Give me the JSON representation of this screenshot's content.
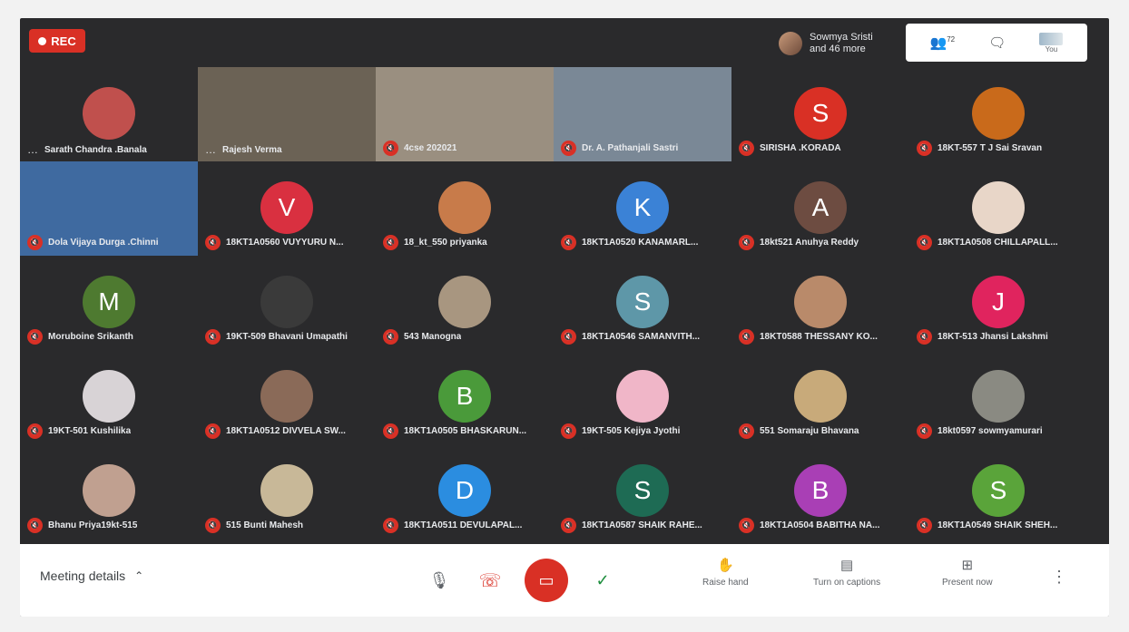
{
  "recording": {
    "label": "REC"
  },
  "presenter": {
    "line1": "Sowmya Sristi",
    "line2": "and 46 more"
  },
  "top_panel": {
    "participant_count": "72",
    "you_label": "You"
  },
  "tiles": [
    {
      "name": "Sarath Chandra .Banala",
      "kind": "photo",
      "color": "#c0504d",
      "status": "more"
    },
    {
      "name": "Rajesh Verma",
      "kind": "video",
      "color": "#6b6255",
      "status": "more"
    },
    {
      "name": "4cse 202021",
      "kind": "video",
      "color": "#9a8f80",
      "status": "muted"
    },
    {
      "name": "Dr. A. Pathanjali Sastri",
      "kind": "video",
      "color": "#7a8896",
      "status": "muted"
    },
    {
      "name": "SIRISHA .KORADA",
      "kind": "letter",
      "letter": "S",
      "color": "#d93025",
      "status": "muted"
    },
    {
      "name": "18KT-557 T J Sai Sravan",
      "kind": "photo",
      "color": "#c96a1b",
      "status": "muted"
    },
    {
      "name": "Dola Vijaya Durga .Chinni",
      "kind": "video",
      "color": "#3f6aa0",
      "status": "muted"
    },
    {
      "name": "18KT1A0560 VUYYURU N...",
      "kind": "letter",
      "letter": "V",
      "color": "#d93040",
      "status": "muted"
    },
    {
      "name": "18_kt_550 priyanka",
      "kind": "photo",
      "color": "#c87b4a",
      "status": "muted"
    },
    {
      "name": "18KT1A0520 KANAMARL...",
      "kind": "letter",
      "letter": "K",
      "color": "#3b82d6",
      "status": "muted"
    },
    {
      "name": "18kt521 Anuhya Reddy",
      "kind": "letter",
      "letter": "A",
      "color": "#6d4c41",
      "status": "muted"
    },
    {
      "name": "18KT1A0508 CHILLAPALL...",
      "kind": "photo",
      "color": "#e8d6c8",
      "status": "muted"
    },
    {
      "name": "Moruboine Srikanth",
      "kind": "letter",
      "letter": "M",
      "color": "#4e7a30",
      "status": "muted"
    },
    {
      "name": "19KT-509 Bhavani Umapathi",
      "kind": "photo",
      "color": "#3a3a3a",
      "status": "muted"
    },
    {
      "name": "543 Manogna",
      "kind": "photo",
      "color": "#a89680",
      "status": "muted"
    },
    {
      "name": "18KT1A0546 SAMANVITH...",
      "kind": "letter",
      "letter": "S",
      "color": "#5e97a8",
      "status": "muted"
    },
    {
      "name": "18KT0588 THESSANY KO...",
      "kind": "photo",
      "color": "#b98a6a",
      "status": "muted"
    },
    {
      "name": "18KT-513 Jhansi Lakshmi",
      "kind": "letter",
      "letter": "J",
      "color": "#e0245e",
      "status": "muted"
    },
    {
      "name": "19KT-501 Kushilika",
      "kind": "photo",
      "color": "#d8d3d6",
      "status": "muted"
    },
    {
      "name": "18KT1A0512 DIVVELA SW...",
      "kind": "photo",
      "color": "#8a6a58",
      "status": "muted"
    },
    {
      "name": "18KT1A0505 BHASKARUN...",
      "kind": "letter",
      "letter": "B",
      "color": "#4a9a3a",
      "status": "muted"
    },
    {
      "name": "19KT-505 Kejiya Jyothi",
      "kind": "photo",
      "color": "#f0b6c8",
      "status": "muted"
    },
    {
      "name": "551 Somaraju Bhavana",
      "kind": "photo",
      "color": "#c8aa7a",
      "status": "muted"
    },
    {
      "name": "18kt0597 sowmyamurari",
      "kind": "photo",
      "color": "#8a8a82",
      "status": "muted"
    },
    {
      "name": "Bhanu Priya19kt-515",
      "kind": "photo",
      "color": "#c0a090",
      "status": "muted"
    },
    {
      "name": "515 Bunti Mahesh",
      "kind": "photo",
      "color": "#c8b898",
      "status": "muted"
    },
    {
      "name": "18KT1A0511 DEVULAPAL...",
      "kind": "letter",
      "letter": "D",
      "color": "#2b8de0",
      "status": "muted"
    },
    {
      "name": "18KT1A0587 SHAIK RAHE...",
      "kind": "letter",
      "letter": "S",
      "color": "#1e6b54",
      "status": "muted"
    },
    {
      "name": "18KT1A0504 BABITHA NA...",
      "kind": "letter",
      "letter": "B",
      "color": "#a93fb5",
      "status": "muted"
    },
    {
      "name": "18KT1A0549 SHAIK SHEH...",
      "kind": "letter",
      "letter": "S",
      "color": "#5aa43a",
      "status": "muted"
    }
  ],
  "bottom_bar": {
    "meeting_details": "Meeting details",
    "raise_hand": "Raise hand",
    "captions": "Turn on captions",
    "present_now": "Present now"
  }
}
